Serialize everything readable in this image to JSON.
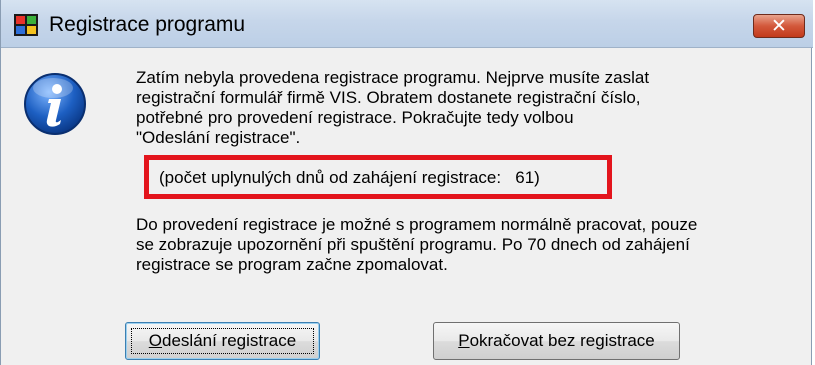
{
  "window": {
    "title": "Registrace programu",
    "close_label": "✕"
  },
  "message": {
    "intro": "Zatím nebyla provedena registrace programu. Nejprve musíte zaslat\nregistrační formulář firmě VIS. Obratem dostanete registrační číslo,\npotřebné pro provedení registrace. Pokračujte tedy volbou\n\"Odeslání registrace\".",
    "days_elapsed": "(počet uplynulých dnů od zahájení registrace:   61)",
    "warning": "Do provedení registrace je možné s programem normálně pracovat, pouze\nse zobrazuje upozornění při spuštění programu. Po 70 dnech od zahájení\nregistrace se program začne zpomalovat."
  },
  "buttons": {
    "send": {
      "mnemonic": "O",
      "rest": "deslání registrace"
    },
    "continue": {
      "mnemonic": "P",
      "rest": "okračovat bez registrace"
    }
  },
  "colors": {
    "highlight": "#e3141c",
    "dialog_bg": "#f0f0f0",
    "info_icon": "#1d5fc2"
  },
  "icons": {
    "app": "windows-flag-icon",
    "info": "info-icon",
    "close": "close-icon"
  }
}
